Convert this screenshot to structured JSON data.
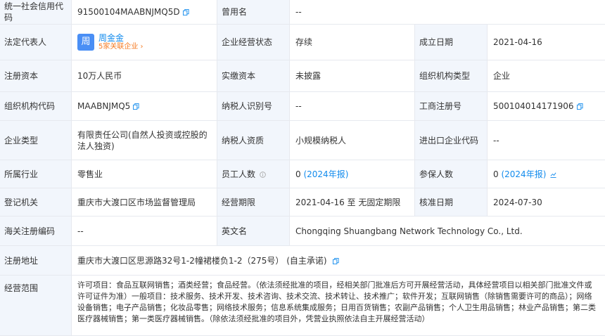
{
  "labels": {
    "credit_code": "统一社会信用代码",
    "former_name": "曾用名",
    "legal_rep": "法定代表人",
    "status": "企业经营状态",
    "established": "成立日期",
    "reg_capital": "注册资本",
    "paid_capital": "实缴资本",
    "org_type": "组织机构类型",
    "org_code": "组织机构代码",
    "taxpayer_id": "纳税人识别号",
    "business_reg_no": "工商注册号",
    "company_type": "企业类型",
    "taxpayer_qual": "纳税人资质",
    "import_export_code": "进出口企业代码",
    "industry": "所属行业",
    "employees": "员工人数",
    "insured": "参保人数",
    "reg_authority": "登记机关",
    "operating_period": "经营期限",
    "approval_date": "核准日期",
    "customs_code": "海关注册编码",
    "english_name": "英文名",
    "reg_address": "注册地址",
    "business_scope": "经营范围"
  },
  "values": {
    "credit_code": "91500104MAABNJMQ5D",
    "former_name": "--",
    "legal_rep_avatar": "周",
    "legal_rep_name": "周金金",
    "legal_rep_related": "5家关联企业 ›",
    "status": "存续",
    "established": "2021-04-16",
    "reg_capital": "10万人民币",
    "paid_capital": "未披露",
    "org_type": "企业",
    "org_code": "MAABNJMQ5",
    "taxpayer_id": "--",
    "business_reg_no": "500104014171906",
    "company_type": "有限责任公司(自然人投资或控股的法人独资)",
    "taxpayer_qual": "小规模纳税人",
    "import_export_code": "--",
    "industry": "零售业",
    "employees": "0",
    "employees_year": "(2024年报)",
    "insured": "0",
    "insured_year": "(2024年报)",
    "reg_authority": "重庆市大渡口区市场监督管理局",
    "operating_period": "2021-04-16 至 无固定期限",
    "approval_date": "2024-07-30",
    "customs_code": "--",
    "english_name": "Chongqing Shuangbang Network Technology Co., Ltd.",
    "reg_address": "重庆市大渡口区思源路32号1-2幢裙楼负1-2（275号） (自主承诺)",
    "business_scope": "许可项目：食品互联网销售；酒类经营；食品经营。（依法须经批准的项目，经相关部门批准后方可开展经营活动，具体经营项目以相关部门批准文件或许可证件为准）一般项目：技术服务、技术开发、技术咨询、技术交流、技术转让、技术推广；软件开发；互联网销售（除销售需要许可的商品）；网络设备销售；电子产品销售；化妆品零售；网络技术服务；信息系统集成服务；日用百货销售；农副产品销售；个人卫生用品销售；林业产品销售；第二类医疗器械销售；第一类医疗器械销售。（除依法须经批准的项目外，凭营业执照依法自主开展经营活动）"
  },
  "watermark": "企知道"
}
